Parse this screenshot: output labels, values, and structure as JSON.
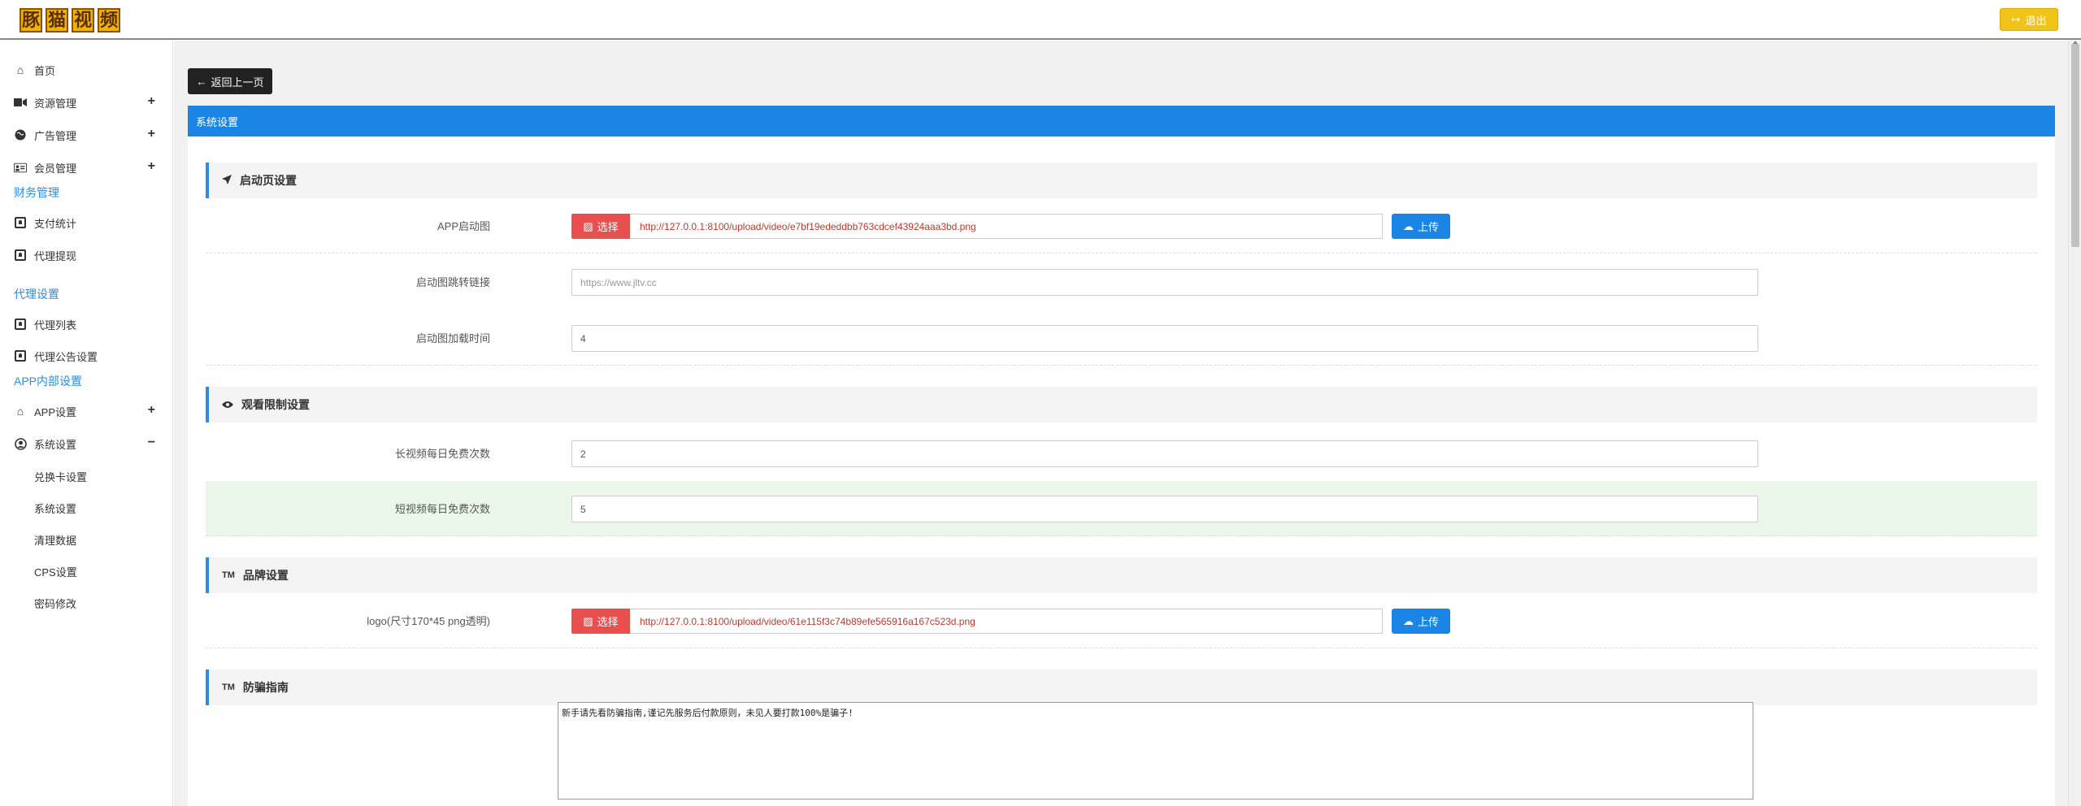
{
  "header": {
    "logo_chars": [
      "豚",
      "猫",
      "视",
      "频"
    ],
    "logout_label": "退出"
  },
  "sidebar": {
    "home": "首页",
    "resource_mgmt": "资源管理",
    "ad_mgmt": "广告管理",
    "member_mgmt": "会员管理",
    "finance_section": "财务管理",
    "pay_stats": "支付统计",
    "agent_withdraw": "代理提现",
    "agent_section": "代理设置",
    "agent_list": "代理列表",
    "agent_notice": "代理公告设置",
    "app_internal_section": "APP内部设置",
    "app_settings": "APP设置",
    "system_settings": "系统设置",
    "sub_items": [
      "兑换卡设置",
      "系统设置",
      "清理数据",
      "CPS设置",
      "密码修改"
    ]
  },
  "main": {
    "back_label": "返回上一页",
    "panel_title": "系统设置",
    "sections": {
      "launch": "启动页设置",
      "watch": "观看限制设置",
      "brand": "品牌设置",
      "antifraud": "防骗指南"
    },
    "fields": {
      "app_launch_label": "APP启动图",
      "app_launch_value": "http://127.0.0.1:8100/upload/video/e7bf19ededdbb763cdcef43924aaa3bd.png",
      "launch_link_label": "启动图跳转链接",
      "launch_link_placeholder": "https://www.jltv.cc",
      "launch_time_label": "启动图加载时间",
      "launch_time_value": "4",
      "long_free_label": "长视频每日免费次数",
      "long_free_value": "2",
      "short_free_label": "短视频每日免费次数",
      "short_free_value": "5",
      "logo_label": "logo(尺寸170*45 png透明)",
      "logo_value": "http://127.0.0.1:8100/upload/video/61e115f3c74b89efe565916a167c523d.png",
      "antifraud_text": "新手请先看防骗指南,谨记先服务后付款原则，未见人要打款100%是骗子!"
    },
    "choose_label": "选择",
    "upload_label": "上传",
    "tm_mark": "TM"
  }
}
